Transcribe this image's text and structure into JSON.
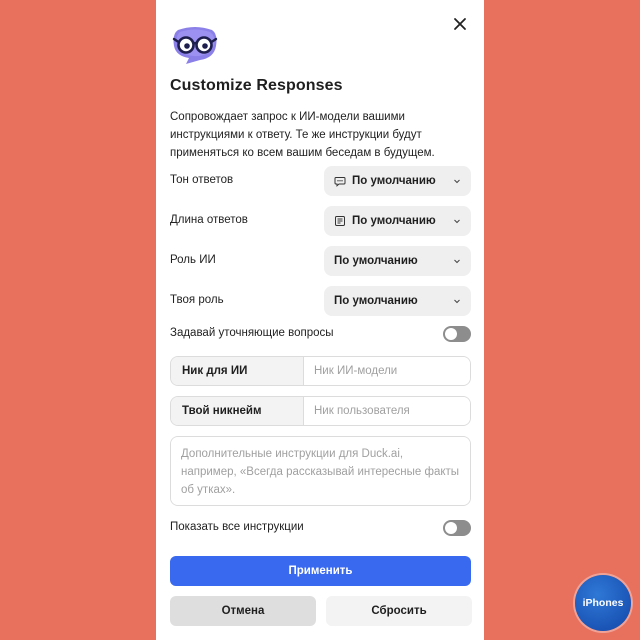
{
  "dialog": {
    "title": "Customize Responses",
    "description": "Сопровождает запрос к ИИ-модели вашими инструкциями к ответу. Те же инструкции будут применяться ко всем вашим беседам в будущем.",
    "close_icon": "close-icon",
    "logo_icon": "duck-ai-logo-icon"
  },
  "settings": [
    {
      "label": "Тон ответов",
      "value": "По умолчанию",
      "icon": "chat-bubble-icon"
    },
    {
      "label": "Длина ответов",
      "value": "По умолчанию",
      "icon": "document-lines-icon"
    },
    {
      "label": "Роль ИИ",
      "value": "По умолчанию",
      "icon": ""
    },
    {
      "label": "Твоя роль",
      "value": "По умолчанию",
      "icon": ""
    }
  ],
  "ask_questions": {
    "label": "Задавай уточняющие вопросы",
    "on": false
  },
  "fields": [
    {
      "label": "Ник для ИИ",
      "placeholder": "Ник ИИ-модели",
      "value": ""
    },
    {
      "label": "Твой никнейм",
      "placeholder": "Ник пользователя",
      "value": ""
    }
  ],
  "instructions": {
    "placeholder": "Дополнительные инструкции для Duck.ai, например, «Всегда рассказывай интересные факты об утках».",
    "value": ""
  },
  "show_all": {
    "label": "Показать все инструкции",
    "on": false
  },
  "buttons": {
    "apply": "Применить",
    "cancel": "Отмена",
    "reset": "Сбросить"
  },
  "colors": {
    "background": "#E8715E",
    "primary": "#3969EF",
    "toggle_off": "#8d8d8d"
  },
  "watermark": {
    "text": "iPhones"
  }
}
